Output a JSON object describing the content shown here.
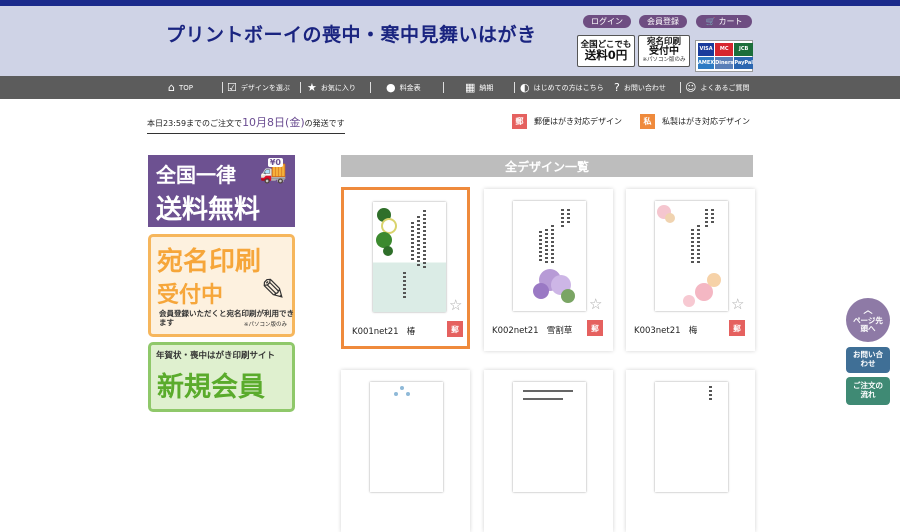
{
  "header": {
    "site_title": "プリントボーイの喪中・寒中見舞いはがき",
    "login": "ログイン",
    "register": "会員登録",
    "cart": "カート",
    "promo_shipping": {
      "line1": "全国どこでも",
      "line2": "送料0円"
    },
    "promo_address": {
      "line1": "宛名印刷",
      "line2": "受付中",
      "note": "※パソコン版のみ"
    },
    "payment_cards": [
      "VISA",
      "MC",
      "JCB",
      "AMEX",
      "Diners",
      "PayPal"
    ]
  },
  "nav": {
    "items": [
      {
        "label": "TOP",
        "icon": "home-icon"
      },
      {
        "label": "デザインを選ぶ",
        "icon": "checklist-icon"
      },
      {
        "label": "お気に入り",
        "icon": "star-icon"
      },
      {
        "label": "料金表",
        "icon": "money-bag-icon"
      },
      {
        "label": "納期",
        "icon": "calendar-icon"
      },
      {
        "label": "はじめての方はこちら",
        "icon": "beginner-icon"
      },
      {
        "label": "お問い合わせ",
        "icon": "question-icon"
      },
      {
        "label": "よくあるご質問",
        "icon": "faq-person-icon"
      }
    ]
  },
  "shipping": {
    "prefix": "本日23:59までのご注文で",
    "date": "10月8日(金)",
    "suffix": "の発送です"
  },
  "legend": {
    "postal": {
      "mark": "郵",
      "label": "郵便はがき対応デザイン",
      "color": "#e5615f"
    },
    "private": {
      "mark": "私",
      "label": "私製はがき対応デザイン",
      "color": "#ef8a3c"
    }
  },
  "sidebar": {
    "banner_shipping": {
      "line1": "全国一律",
      "line2": "送料無料",
      "price_tag": "¥0"
    },
    "banner_address": {
      "line1": "宛名印刷",
      "line2": "受付中",
      "desc": "会員登録いただくと宛名印刷が利用できます",
      "note": "※パソコン版のみ"
    },
    "banner_member": {
      "line1": "年賀状・喪中はがき印刷サイト",
      "line2": "新規会員"
    }
  },
  "main": {
    "section_title": "全デザイン一覧",
    "designs": [
      {
        "code": "K001net21",
        "name": "椿",
        "mark": "郵",
        "selected": true
      },
      {
        "code": "K002net21",
        "name": "雪割草",
        "mark": "郵",
        "selected": false
      },
      {
        "code": "K003net21",
        "name": "梅",
        "mark": "郵",
        "selected": false
      }
    ]
  },
  "floating": {
    "page_top": "ページ先頭へ",
    "contact": "お問い合わせ",
    "order_flow": "ご注文の流れ"
  },
  "colors": {
    "brand_navy": "#1a2480",
    "header_bg": "#cfd3e6",
    "nav_bg": "#5c5c5c",
    "purple": "#6d5191",
    "orange": "#ef8a3c",
    "red": "#e5615f"
  }
}
